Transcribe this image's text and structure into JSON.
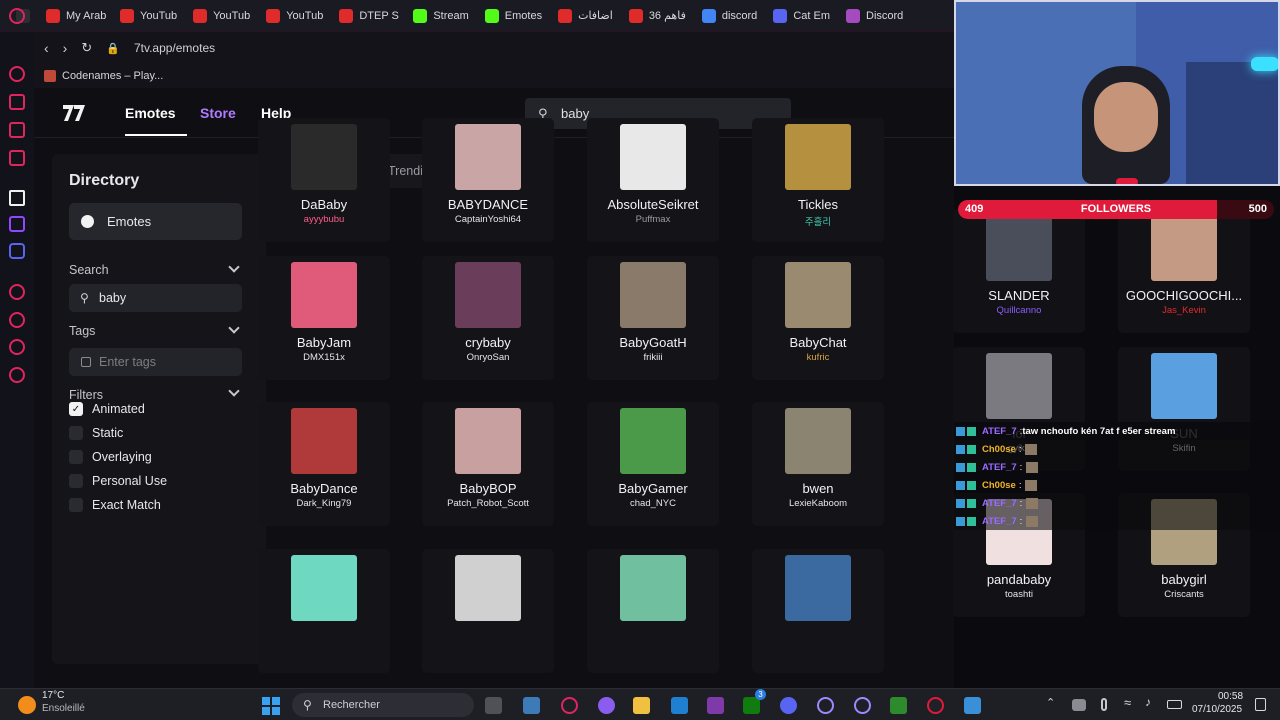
{
  "bookmarks": [
    {
      "label": "",
      "color": "#2d2d36"
    },
    {
      "label": "My Arab",
      "color": "#e02b2b"
    },
    {
      "label": "YouTub",
      "color": "#e02b2b"
    },
    {
      "label": "YouTub",
      "color": "#e02b2b"
    },
    {
      "label": "YouTub",
      "color": "#e02b2b"
    },
    {
      "label": "DTEP S",
      "color": "#e02b2b"
    },
    {
      "label": "Stream",
      "color": "#53fc18"
    },
    {
      "label": "Emotes",
      "color": "#53fc18"
    },
    {
      "label": "اضافات",
      "color": "#e02b2b"
    },
    {
      "label": "36 فاهم",
      "color": "#e02b2b"
    },
    {
      "label": "discord",
      "color": "#4285f4"
    },
    {
      "label": "Cat Em",
      "color": "#5865f2"
    },
    {
      "label": "Discord",
      "color": "#a64bbf"
    }
  ],
  "browser": {
    "url": "7tv.app/emotes",
    "tab_title": "Codenames – Play..."
  },
  "nav": {
    "emotes": "Emotes",
    "store": "Store",
    "help": "Help",
    "search_value": "baby"
  },
  "directory": {
    "title": "Directory",
    "emotes_label": "Emotes",
    "search_label": "Search",
    "search_value": "baby",
    "tags_label": "Tags",
    "tags_placeholder": "Enter tags",
    "filters_label": "Filters",
    "filters": [
      {
        "label": "Animated",
        "checked": true
      },
      {
        "label": "Static",
        "checked": false
      },
      {
        "label": "Overlaying",
        "checked": false
      },
      {
        "label": "Personal Use",
        "checked": false
      },
      {
        "label": "Exact Match",
        "checked": false
      }
    ]
  },
  "sort_tabs": [
    {
      "label": "Top",
      "active": true
    },
    {
      "label": "Trending",
      "active": false
    },
    {
      "label": "New",
      "active": false
    }
  ],
  "emotes": [
    {
      "name": "DaBaby",
      "author": "ayyybubu",
      "author_color": "#ff5c8a",
      "thumb": "#2a2a2a"
    },
    {
      "name": "BABYDANCE",
      "author": "CaptainYoshi64",
      "author_color": "#e6e6ea",
      "thumb": "#c9a5a5"
    },
    {
      "name": "AbsoluteSeikret",
      "author": "Puffmax",
      "author_color": "#9a9aa0",
      "thumb": "#e8e8e8"
    },
    {
      "name": "Tickles",
      "author": "주흘리",
      "author_color": "#3fc9b0",
      "thumb": "#b5913f"
    },
    {
      "name": "SLANDER",
      "author": "Quillcanno",
      "author_color": "#8c5cff",
      "thumb": "#4a4e5a"
    },
    {
      "name": "GOOCHIGOOCHI...",
      "author": "Jas_Kevin",
      "author_color": "#e02b2b",
      "thumb": "#c59a84"
    },
    {
      "name": "BabyJam",
      "author": "DMX151x",
      "author_color": "#e6e6ea",
      "thumb": "#e05a7a"
    },
    {
      "name": "crybaby",
      "author": "OnryoSan",
      "author_color": "#e6e6ea",
      "thumb": "#6a3e5a"
    },
    {
      "name": "BabyGoatH",
      "author": "frikiii",
      "author_color": "#e6e6ea",
      "thumb": "#8a7a6a"
    },
    {
      "name": "BabyChat",
      "author": "kufric",
      "author_color": "#d9a441",
      "thumb": "#9a8a70"
    },
    {
      "name": "lol",
      "author": "gyika",
      "author_color": "#e6e6ea",
      "thumb": "#7a7a80"
    },
    {
      "name": "SUN",
      "author": "Skifin",
      "author_color": "#e6e6ea",
      "thumb": "#5aa0e0"
    },
    {
      "name": "BabyDance",
      "author": "Dark_King79",
      "author_color": "#e6e6ea",
      "thumb": "#b03a3a"
    },
    {
      "name": "BabyBOP",
      "author": "Patch_Robot_Scott",
      "author_color": "#e6e6ea",
      "thumb": "#c9a0a0"
    },
    {
      "name": "BabyGamer",
      "author": "chad_NYC",
      "author_color": "#e6e6ea",
      "thumb": "#4a9a4a"
    },
    {
      "name": "bwen",
      "author": "LexieKaboom",
      "author_color": "#e6e6ea",
      "thumb": "#8a8470"
    },
    {
      "name": "pandababy",
      "author": "toashti",
      "author_color": "#e6e6ea",
      "thumb": "#f0e0e0"
    },
    {
      "name": "babygirl",
      "author": "Criscants",
      "author_color": "#e6e6ea",
      "thumb": "#b0a080"
    },
    {
      "name": "",
      "author": "",
      "author_color": "#e6e6ea",
      "thumb": "#6ed9c0"
    },
    {
      "name": "",
      "author": "",
      "author_color": "#e6e6ea",
      "thumb": "#d0d0d0"
    },
    {
      "name": "",
      "author": "",
      "author_color": "#e6e6ea",
      "thumb": "#70c0a0"
    },
    {
      "name": "",
      "author": "",
      "author_color": "#e6e6ea",
      "thumb": "#3a6aa0"
    },
    {
      "name": "",
      "author": "",
      "author_color": "#e6e6ea",
      "thumb": "#8a6a5a"
    },
    {
      "name": "",
      "author": "",
      "author_color": "#e6e6ea",
      "thumb": "#9a9a8a"
    }
  ],
  "stream": {
    "followers_current": "409",
    "followers_label": "FOLLOWERS",
    "followers_goal": "500",
    "followers_progress": 0.82,
    "chat": [
      {
        "user": "ATEF_7",
        "user_color": "#9b6bff",
        "message": "taw nchoufo kén 7at f e5er stream",
        "emote": false
      },
      {
        "user": "Ch00se",
        "user_color": "#f0b429",
        "message": "",
        "emote": true
      },
      {
        "user": "ATEF_7",
        "user_color": "#9b6bff",
        "message": "",
        "emote": true
      },
      {
        "user": "Ch00se",
        "user_color": "#f0b429",
        "message": "",
        "emote": true
      },
      {
        "user": "ATEF_7",
        "user_color": "#9b6bff",
        "message": "",
        "emote": true
      },
      {
        "user": "ATEF_7",
        "user_color": "#9b6bff",
        "message": "",
        "emote": true
      }
    ]
  },
  "taskbar": {
    "weather_temp": "17°C",
    "weather_desc": "Ensoleillé",
    "search_placeholder": "Rechercher",
    "time": "00:58",
    "date": "07/10/2025",
    "notification_count": "3"
  }
}
